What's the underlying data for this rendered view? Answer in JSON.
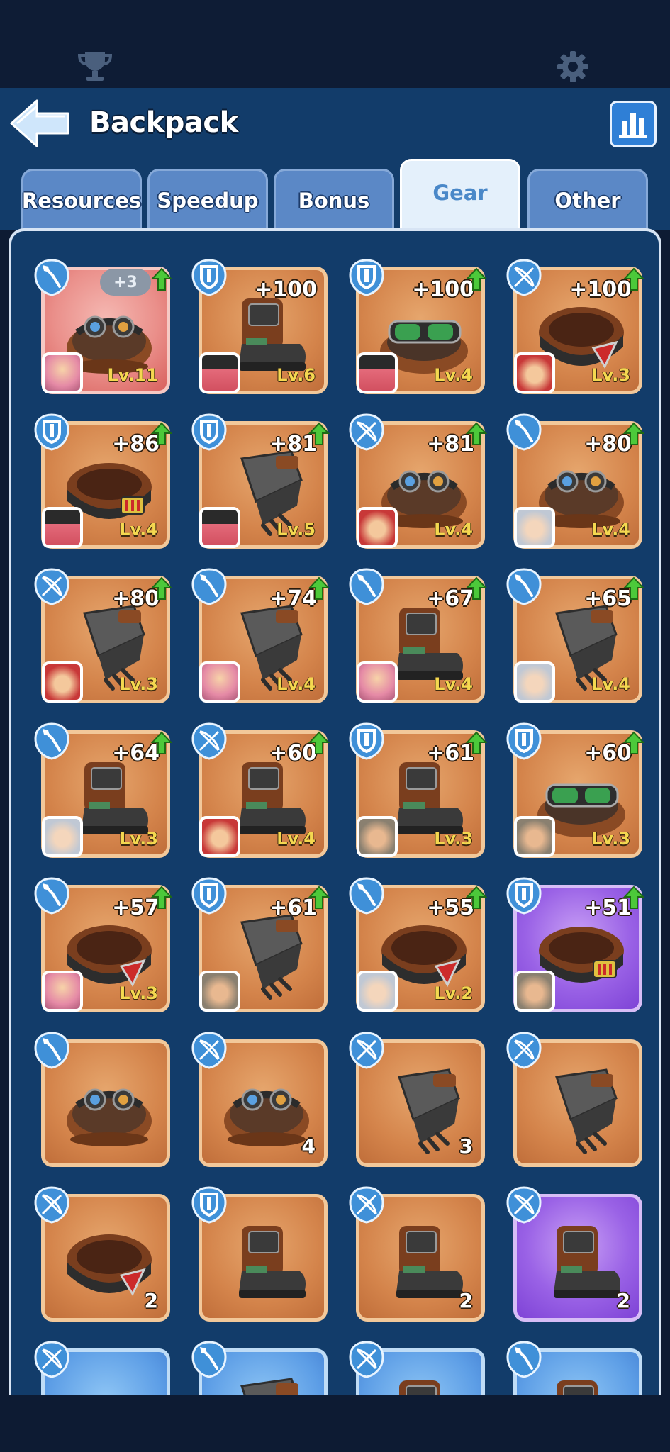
{
  "header": {
    "title": "Backpack",
    "icons": {
      "top_left": "trophy-icon",
      "top_right": "gear-icon",
      "back": "back-arrow-icon",
      "stats": "bar-chart-icon"
    }
  },
  "tabs": [
    {
      "label": "Resources",
      "active": false
    },
    {
      "label": "Speedup",
      "active": false
    },
    {
      "label": "Bonus",
      "active": false
    },
    {
      "label": "Gear",
      "active": true
    },
    {
      "label": "Other",
      "active": false
    }
  ],
  "colors": {
    "background": "#123c6a",
    "card_orange": "#d4844b",
    "card_red": "#ea8f8a",
    "card_purple": "#9a62e6",
    "card_blue": "#5d9ee6",
    "level_yellow": "#f4d850",
    "active_tab_text": "#4a88c8"
  },
  "items": [
    {
      "type": "shovel",
      "bg": "red",
      "bonus": "",
      "pill": "+3",
      "level": "Lv.11",
      "qty": "",
      "art": "goggles-helmet",
      "avatar": "pink",
      "arrow": true
    },
    {
      "type": "shield",
      "bg": "orange",
      "bonus": "+100",
      "pill": "",
      "level": "Lv.6",
      "qty": "",
      "art": "boot",
      "avatar": "tophat",
      "arrow": false
    },
    {
      "type": "shield",
      "bg": "orange",
      "bonus": "+100",
      "pill": "",
      "level": "Lv.4",
      "qty": "",
      "art": "goggles-green",
      "avatar": "tophat",
      "arrow": true
    },
    {
      "type": "bow",
      "bg": "orange",
      "bonus": "+100",
      "pill": "",
      "level": "Lv.3",
      "qty": "",
      "art": "belt-red",
      "avatar": "redhood",
      "arrow": true
    },
    {
      "type": "shield",
      "bg": "orange",
      "bonus": "+86",
      "pill": "",
      "level": "Lv.4",
      "qty": "",
      "art": "belt-gold",
      "avatar": "tophat",
      "arrow": true
    },
    {
      "type": "shield",
      "bg": "orange",
      "bonus": "+81",
      "pill": "",
      "level": "Lv.5",
      "qty": "",
      "art": "gauntlet",
      "avatar": "tophat",
      "arrow": true
    },
    {
      "type": "bow",
      "bg": "orange",
      "bonus": "+81",
      "pill": "",
      "level": "Lv.4",
      "qty": "",
      "art": "goggles-helmet",
      "avatar": "redhood",
      "arrow": true
    },
    {
      "type": "shovel",
      "bg": "orange",
      "bonus": "+80",
      "pill": "",
      "level": "Lv.4",
      "qty": "",
      "art": "goggles-helmet",
      "avatar": "silver",
      "arrow": true
    },
    {
      "type": "bow",
      "bg": "orange",
      "bonus": "+80",
      "pill": "",
      "level": "Lv.3",
      "qty": "",
      "art": "gauntlet",
      "avatar": "redhood",
      "arrow": true
    },
    {
      "type": "shovel",
      "bg": "orange",
      "bonus": "+74",
      "pill": "",
      "level": "Lv.4",
      "qty": "",
      "art": "gauntlet",
      "avatar": "pink",
      "arrow": true
    },
    {
      "type": "shovel",
      "bg": "orange",
      "bonus": "+67",
      "pill": "",
      "level": "Lv.4",
      "qty": "",
      "art": "boot",
      "avatar": "pink",
      "arrow": true
    },
    {
      "type": "shovel",
      "bg": "orange",
      "bonus": "+65",
      "pill": "",
      "level": "Lv.4",
      "qty": "",
      "art": "gauntlet",
      "avatar": "silver",
      "arrow": true
    },
    {
      "type": "shovel",
      "bg": "orange",
      "bonus": "+64",
      "pill": "",
      "level": "Lv.3",
      "qty": "",
      "art": "boot",
      "avatar": "silver",
      "arrow": true
    },
    {
      "type": "bow",
      "bg": "orange",
      "bonus": "+60",
      "pill": "",
      "level": "Lv.4",
      "qty": "",
      "art": "boot",
      "avatar": "redhood",
      "arrow": true
    },
    {
      "type": "shield",
      "bg": "orange",
      "bonus": "+61",
      "pill": "",
      "level": "Lv.3",
      "qty": "",
      "art": "boot",
      "avatar": "hood",
      "arrow": true
    },
    {
      "type": "shield",
      "bg": "orange",
      "bonus": "+60",
      "pill": "",
      "level": "Lv.3",
      "qty": "",
      "art": "goggles-green",
      "avatar": "hood",
      "arrow": true
    },
    {
      "type": "shovel",
      "bg": "orange",
      "bonus": "+57",
      "pill": "",
      "level": "Lv.3",
      "qty": "",
      "art": "belt-red",
      "avatar": "pink",
      "arrow": true
    },
    {
      "type": "shield",
      "bg": "orange",
      "bonus": "+61",
      "pill": "",
      "level": "",
      "qty": "",
      "art": "gauntlet",
      "avatar": "hood",
      "arrow": true
    },
    {
      "type": "shovel",
      "bg": "orange",
      "bonus": "+55",
      "pill": "",
      "level": "Lv.2",
      "qty": "",
      "art": "belt-red",
      "avatar": "silver",
      "arrow": true
    },
    {
      "type": "shield",
      "bg": "purple",
      "bonus": "+51",
      "pill": "",
      "level": "",
      "qty": "",
      "art": "belt-gold",
      "avatar": "hood",
      "arrow": true
    },
    {
      "type": "shovel",
      "bg": "orange",
      "bonus": "",
      "pill": "",
      "level": "",
      "qty": "",
      "art": "goggles-helmet",
      "avatar": "",
      "arrow": false
    },
    {
      "type": "bow",
      "bg": "orange",
      "bonus": "",
      "pill": "",
      "level": "",
      "qty": "4",
      "art": "goggles-helmet",
      "avatar": "",
      "arrow": false
    },
    {
      "type": "bow",
      "bg": "orange",
      "bonus": "",
      "pill": "",
      "level": "",
      "qty": "3",
      "art": "gauntlet",
      "avatar": "",
      "arrow": false
    },
    {
      "type": "bow",
      "bg": "orange",
      "bonus": "",
      "pill": "",
      "level": "",
      "qty": "",
      "art": "gauntlet",
      "avatar": "",
      "arrow": false
    },
    {
      "type": "bow",
      "bg": "orange",
      "bonus": "",
      "pill": "",
      "level": "",
      "qty": "2",
      "art": "belt-red",
      "avatar": "",
      "arrow": false
    },
    {
      "type": "shield",
      "bg": "orange",
      "bonus": "",
      "pill": "",
      "level": "",
      "qty": "",
      "art": "boot",
      "avatar": "",
      "arrow": false
    },
    {
      "type": "bow",
      "bg": "orange",
      "bonus": "",
      "pill": "",
      "level": "",
      "qty": "2",
      "art": "boot",
      "avatar": "",
      "arrow": false
    },
    {
      "type": "bow",
      "bg": "purple",
      "bonus": "",
      "pill": "",
      "level": "",
      "qty": "2",
      "art": "boot",
      "avatar": "",
      "arrow": false
    },
    {
      "type": "bow",
      "bg": "blue",
      "bonus": "",
      "pill": "",
      "level": "",
      "qty": "",
      "art": "goggles-helmet",
      "avatar": "",
      "arrow": false
    },
    {
      "type": "shovel",
      "bg": "blue",
      "bonus": "",
      "pill": "",
      "level": "",
      "qty": "",
      "art": "gauntlet",
      "avatar": "",
      "arrow": false
    },
    {
      "type": "bow",
      "bg": "blue",
      "bonus": "",
      "pill": "",
      "level": "",
      "qty": "",
      "art": "boot",
      "avatar": "",
      "arrow": false
    },
    {
      "type": "shovel",
      "bg": "blue",
      "bonus": "",
      "pill": "",
      "level": "",
      "qty": "",
      "art": "boot",
      "avatar": "",
      "arrow": false
    }
  ]
}
